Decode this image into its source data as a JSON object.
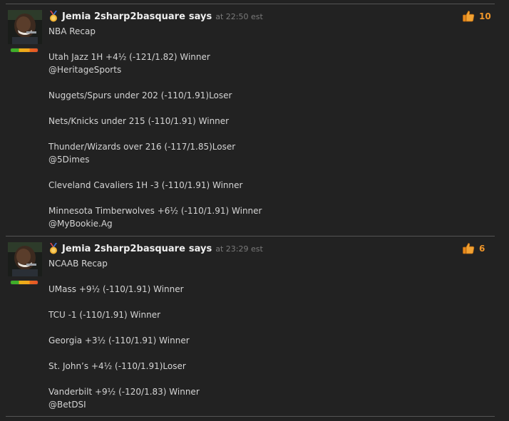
{
  "posts": [
    {
      "author": "Jemia 2sharp2basquare",
      "says": "says",
      "time": "at 22:50 est",
      "likes": "10",
      "lines": [
        "NBA Recap",
        "",
        "Utah Jazz 1H +4½ (-121/1.82) Winner",
        "@HeritageSports",
        "",
        "Nuggets/Spurs under 202 (-110/1.91)Loser",
        "",
        "Nets/Knicks under 215 (-110/1.91) Winner",
        "",
        "Thunder/Wizards over 216 (-117/1.85)Loser",
        "@5Dimes",
        "",
        "Cleveland Cavaliers 1H -3 (-110/1.91) Winner",
        "",
        "Minnesota Timberwolves +6½ (-110/1.91) Winner",
        "@MyBookie.Ag"
      ]
    },
    {
      "author": "Jemia 2sharp2basquare",
      "says": "says",
      "time": "at 23:29 est",
      "likes": "6",
      "lines": [
        "NCAAB Recap",
        "",
        "UMass +9½ (-110/1.91) Winner",
        "",
        "TCU -1 (-110/1.91) Winner",
        "",
        "Georgia +3½ (-110/1.91) Winner",
        "",
        "St. John’s +4½ (-110/1.91)Loser",
        "",
        "Vanderbilt +9½ (-120/1.83) Winner",
        "@BetDSI"
      ]
    }
  ],
  "colors": {
    "background": "#222222",
    "username": "#eeeeee",
    "timestamp": "#7a7a7a",
    "like_count": "#f0962a",
    "divider": "#555555"
  },
  "icons": {
    "medal": "medal-icon",
    "thumbs_up": "thumbs-up-icon"
  }
}
